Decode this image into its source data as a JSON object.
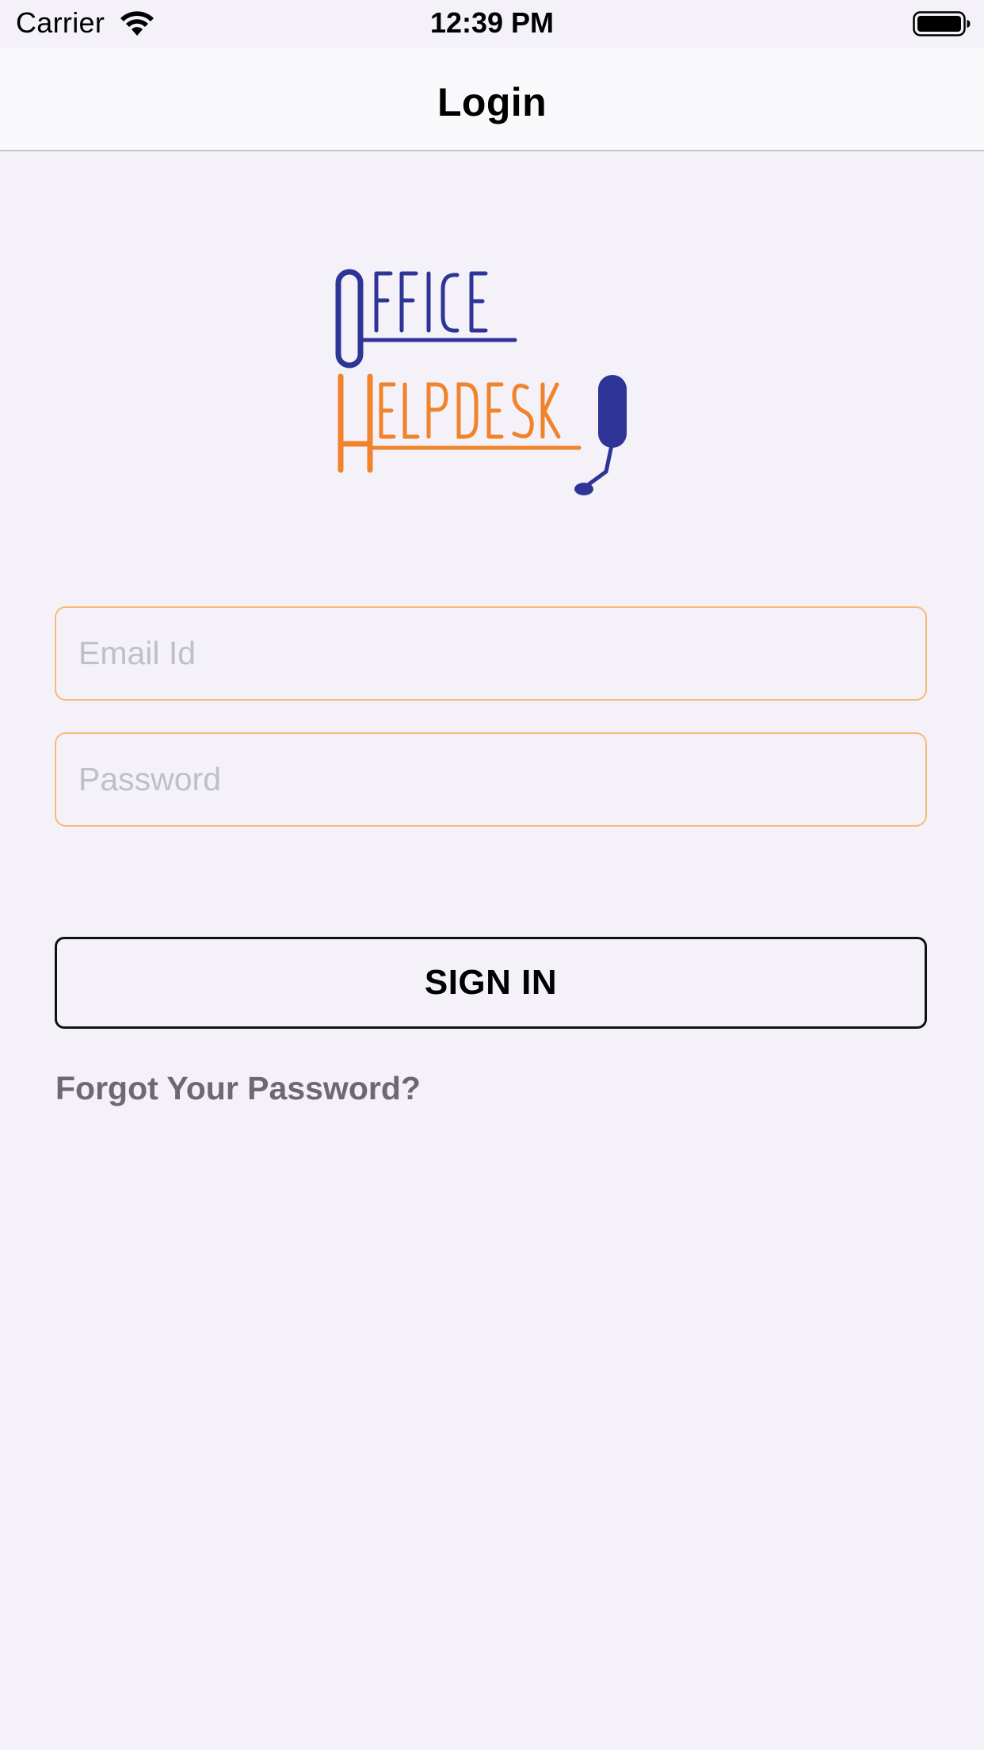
{
  "status_bar": {
    "carrier": "Carrier",
    "time": "12:39 PM",
    "wifi_icon": "wifi-icon",
    "battery_icon": "battery-icon"
  },
  "nav": {
    "title": "Login"
  },
  "logo": {
    "line1": "OFFICE",
    "line2": "HELPDESK",
    "primary_color": "#2f3596",
    "secondary_color": "#f0832b"
  },
  "form": {
    "email_placeholder": "Email Id",
    "email_value": "",
    "password_placeholder": "Password",
    "password_value": "",
    "sign_in_label": "SIGN IN",
    "forgot_label": "Forgot Your Password?"
  },
  "colors": {
    "background": "#f4f2f8",
    "input_border": "#f7bb74",
    "link_gray": "#6c6a70"
  }
}
